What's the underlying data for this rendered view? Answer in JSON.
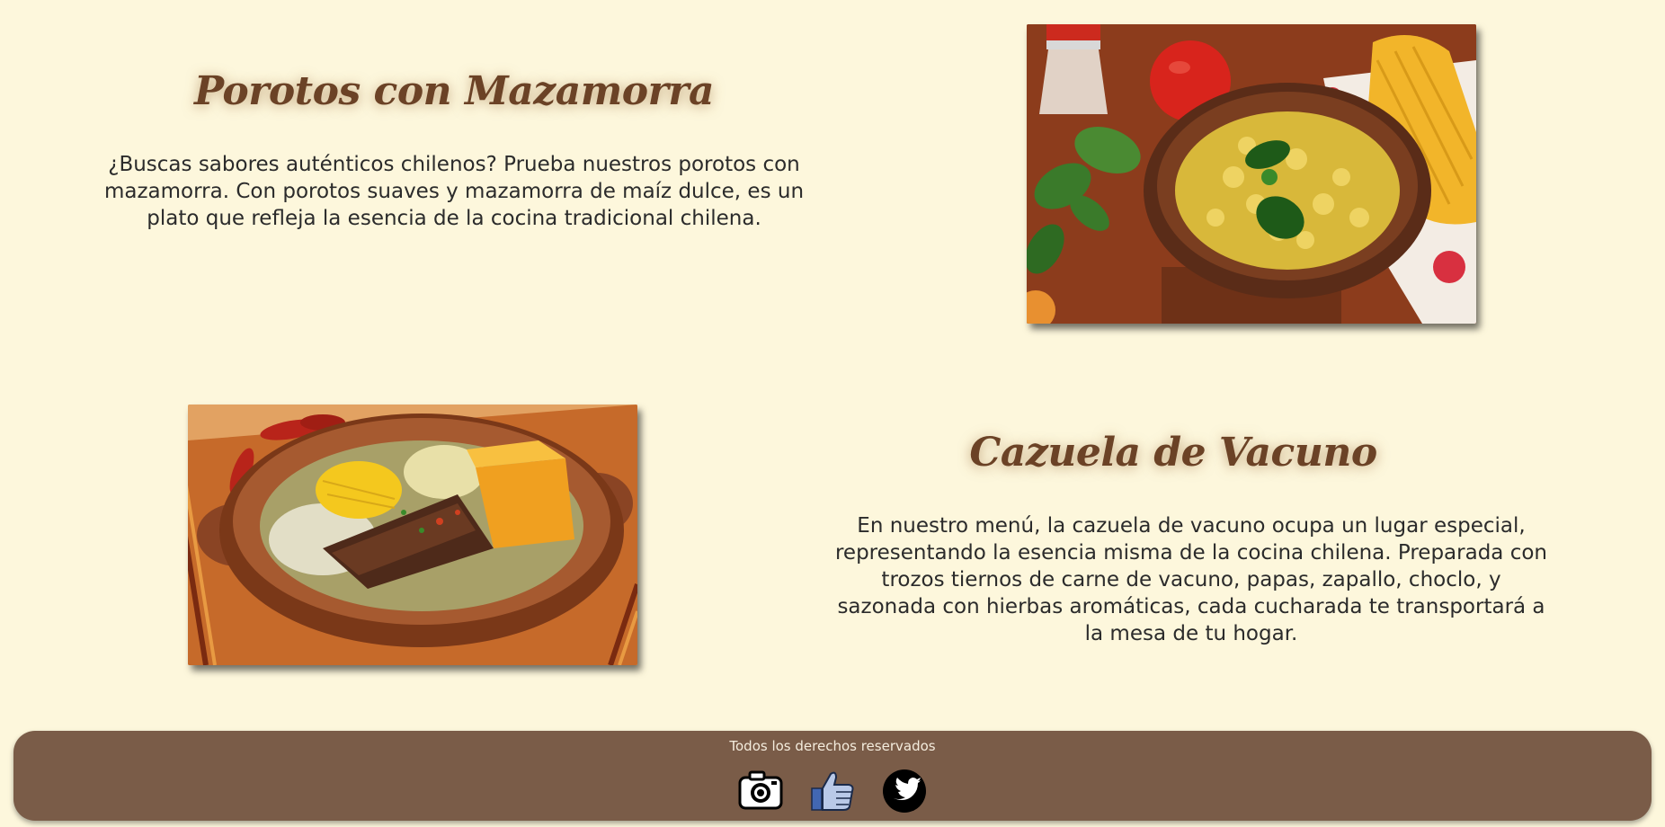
{
  "dishes": [
    {
      "title": "Porotos con Mazamorra",
      "description": "¿Buscas sabores auténticos chilenos? Prueba nuestros porotos con mazamorra. Con porotos suaves y mazamorra de maíz dulce, es un plato que refleja la esencia de la cocina tradicional chilena."
    },
    {
      "title": "Cazuela de Vacuno",
      "description": "En nuestro menú, la cazuela de vacuno ocupa un lugar especial, representando la esencia misma de la cocina chilena. Preparada con trozos tiernos de carne de vacuno, papas, zapallo, choclo, y sazonada con hierbas aromáticas, cada cucharada te transportará a la mesa de tu hogar."
    }
  ],
  "footer": {
    "copyright": "Todos los derechos reservados",
    "social_icons": [
      "camera-icon",
      "like-icon",
      "twitter-icon"
    ]
  },
  "colors": {
    "background": "#fdf7dc",
    "title": "#6b4226",
    "footer": "#7a5c48",
    "text": "#2b2b2b"
  }
}
